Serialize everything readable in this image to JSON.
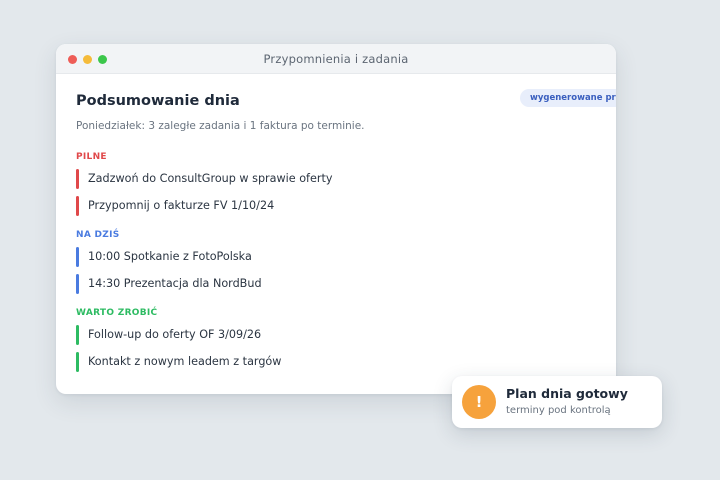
{
  "window": {
    "title": "Przypomnienia i zadania"
  },
  "panel": {
    "heading": "Podsumowanie dnia",
    "ai_badge": "wygenerowane przez AI",
    "summary": "Poniedziałek: 3 zaległe zadania i 1 faktura po terminie."
  },
  "sections": {
    "urgent": {
      "title": "PILNE",
      "color": "#e0484a",
      "tasks": [
        "Zadzwoń do ConsultGroup w sprawie oferty",
        "Przypomnij o fakturze FV 1/10/24"
      ]
    },
    "today": {
      "title": "NA DZIŚ",
      "color": "#4a7be0",
      "tasks": [
        "10:00 Spotkanie z FotoPolska",
        "14:30 Prezentacja dla NordBud"
      ]
    },
    "worth": {
      "title": "WARTO ZROBIĆ",
      "color": "#2dbb62",
      "tasks": [
        "Follow-up do oferty OF 3/09/26",
        "Kontakt z nowym leadem z targów"
      ]
    }
  },
  "toast": {
    "icon": "warning-icon",
    "icon_glyph": "!",
    "icon_color": "#f6a23c",
    "title": "Plan dnia gotowy",
    "subtitle": "terminy pod kontrolą"
  }
}
